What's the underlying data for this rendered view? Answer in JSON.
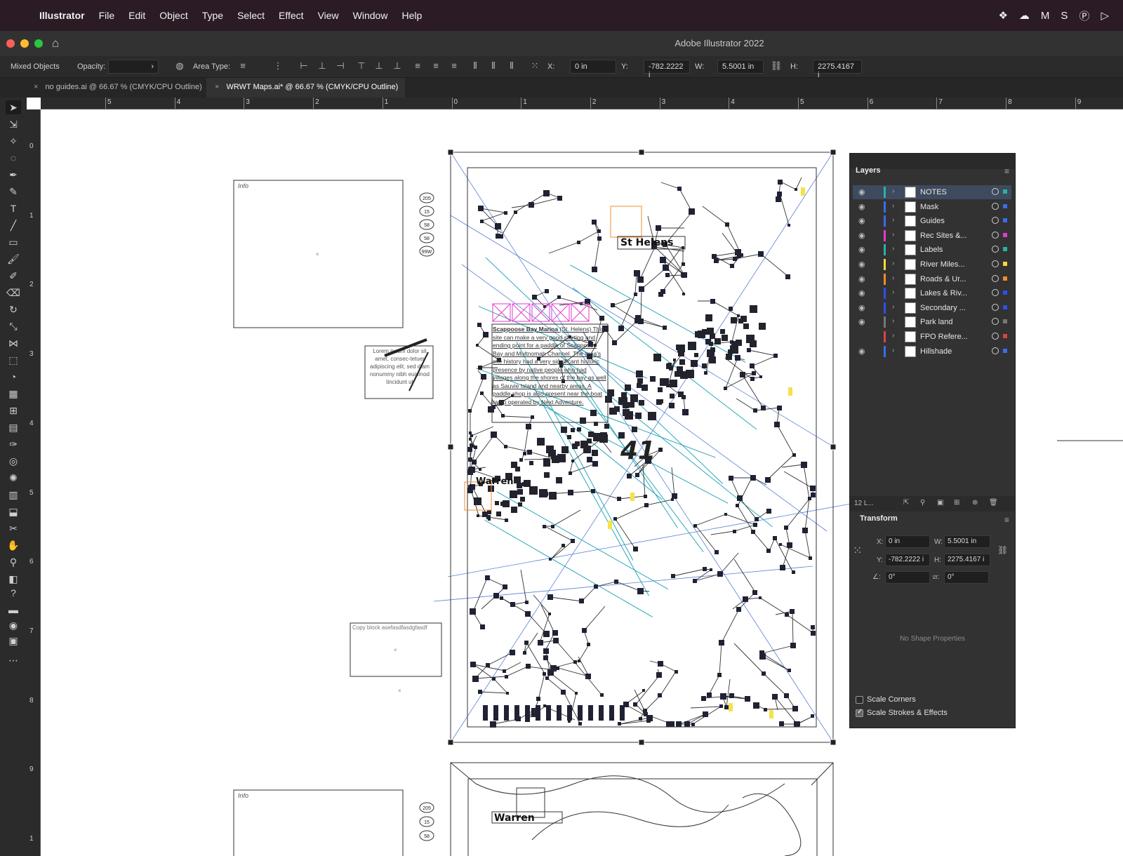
{
  "menubar": {
    "apple_icon": "apple-logo-icon",
    "items": [
      "Illustrator",
      "File",
      "Edit",
      "Object",
      "Type",
      "Select",
      "Effect",
      "View",
      "Window",
      "Help"
    ],
    "tray_icons": [
      "dropbox-icon",
      "creative-cloud-icon",
      "malwarebytes-icon",
      "s-icon",
      "p-icon",
      "play-icon"
    ]
  },
  "window": {
    "title": "Adobe Illustrator 2022"
  },
  "control_bar": {
    "selection_type": "Mixed Objects",
    "opacity_label": "Opacity:",
    "area_type_label": "Area Type:",
    "x_label": "X:",
    "x_value": "0 in",
    "y_label": "Y:",
    "y_value": "-782.2222 i",
    "w_label": "W:",
    "w_value": "5.5001 in",
    "h_label": "H:",
    "h_value": "2275.4167 i"
  },
  "tabs": [
    {
      "label": "no guides.ai @ 66.67 % (CMYK/CPU Outline)",
      "close": "×"
    },
    {
      "label": "WRWT Maps.ai* @ 66.67 % (CMYK/CPU Outline)",
      "close": "×"
    }
  ],
  "ruler": {
    "h_numbers": [
      "5",
      "4",
      "3",
      "2",
      "1",
      "0",
      "1",
      "2",
      "3",
      "4",
      "5",
      "6",
      "7",
      "8",
      "9"
    ],
    "v_numbers": [
      "0",
      "1",
      "2",
      "3",
      "4",
      "5",
      "6",
      "7",
      "8",
      "9",
      "1"
    ]
  },
  "canvas": {
    "info_label": "Info",
    "lorem_text": "Lorem ipsum dolor sit amet, consec-tetuer adipiscing elit, sed diam nonummy nibh euismod tincidunt ut",
    "copy_block": "Copy block asefasdfasdgfasdf",
    "notes_heading": "Scappoose Bay Marina",
    "notes_text": "(St. Helens) This site can make a very good starting and ending point for a paddle of Scappoose Bay and Multnomah Channel. The area's site history had a very significant historic presence by native people who had villages along the shores of the bay as well as Sauvie Island and nearby areas. A paddle shop is also present near the boat ramp operated by Next Adventure.",
    "st_helens": "St Helens",
    "warren": "Warren",
    "warren2": "Warren",
    "big_number": "41",
    "shields": [
      "205",
      "15",
      "58",
      "58",
      "99W"
    ],
    "shields2": [
      "205",
      "15",
      "58"
    ]
  },
  "layers_panel": {
    "title": "Layers",
    "count": "12 L...",
    "layers": [
      {
        "name": "NOTES",
        "color": "#27b3a5",
        "visible": true,
        "selected": true
      },
      {
        "name": "Mask",
        "color": "#3b6cf0",
        "visible": true
      },
      {
        "name": "Guides",
        "color": "#3b6cf0",
        "visible": true
      },
      {
        "name": "Rec Sites &...",
        "color": "#e23ad0",
        "visible": true
      },
      {
        "name": "Labels",
        "color": "#27b3a5",
        "visible": true
      },
      {
        "name": "River Miles...",
        "color": "#f5d83a",
        "visible": true
      },
      {
        "name": "Roads & Ur...",
        "color": "#f28c28",
        "visible": true
      },
      {
        "name": "Lakes & Riv...",
        "color": "#2e4ff0",
        "visible": true
      },
      {
        "name": "Secondary ...",
        "color": "#2e4ff0",
        "visible": true
      },
      {
        "name": "Park land",
        "color": "#777777",
        "visible": true
      },
      {
        "name": "FPO Refere...",
        "color": "#e04040",
        "visible": false
      },
      {
        "name": "Hillshade",
        "color": "#3b6cf0",
        "visible": true
      }
    ]
  },
  "transform_panel": {
    "title": "Transform",
    "x_label": "X:",
    "x_value": "0 in",
    "w_label": "W:",
    "w_value": "5.5001 in",
    "y_label": "Y:",
    "y_value": "-782.2222 i",
    "h_label": "H:",
    "h_value": "2275.4167 i",
    "angle_value": "0°",
    "shear_value": "0°",
    "no_shape": "No Shape Properties",
    "scale_corners": "Scale Corners",
    "scale_strokes": "Scale Strokes & Effects",
    "scale_corners_checked": false,
    "scale_strokes_checked": true
  }
}
